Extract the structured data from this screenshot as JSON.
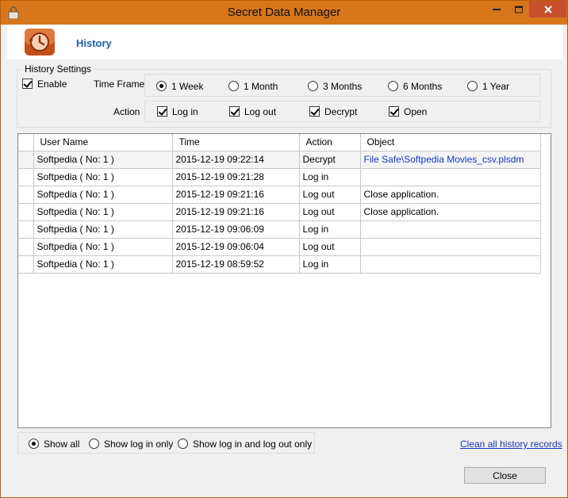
{
  "window": {
    "title": "Secret Data Manager"
  },
  "header": {
    "title": "History"
  },
  "settings": {
    "legend": "History Settings",
    "enable_label": "Enable",
    "enable_checked": true,
    "timeframe_label": "Time Frame",
    "timeframes": [
      {
        "label": "1 Week",
        "selected": true
      },
      {
        "label": "1 Month",
        "selected": false
      },
      {
        "label": "3 Months",
        "selected": false
      },
      {
        "label": "6 Months",
        "selected": false
      },
      {
        "label": "1 Year",
        "selected": false
      }
    ],
    "action_label": "Action",
    "actions": [
      {
        "label": "Log in",
        "checked": true
      },
      {
        "label": "Log out",
        "checked": true
      },
      {
        "label": "Decrypt",
        "checked": true
      },
      {
        "label": "Open",
        "checked": true
      }
    ]
  },
  "table": {
    "columns": [
      "User Name",
      "Time",
      "Action",
      "Object"
    ],
    "rows": [
      {
        "user": "Softpedia ( No: 1 )",
        "time": "2015-12-19 09:22:14",
        "action": "Decrypt",
        "object": "File Safe\\Softpedia Movies_csv.plsdm"
      },
      {
        "user": "Softpedia ( No: 1 )",
        "time": "2015-12-19 09:21:28",
        "action": "Log in",
        "object": ""
      },
      {
        "user": "Softpedia ( No: 1 )",
        "time": "2015-12-19 09:21:16",
        "action": "Log out",
        "object": "Close application."
      },
      {
        "user": "Softpedia ( No: 1 )",
        "time": "2015-12-19 09:21:16",
        "action": "Log out",
        "object": "Close application."
      },
      {
        "user": "Softpedia ( No: 1 )",
        "time": "2015-12-19 09:06:09",
        "action": "Log in",
        "object": ""
      },
      {
        "user": "Softpedia ( No: 1 )",
        "time": "2015-12-19 09:06:04",
        "action": "Log out",
        "object": ""
      },
      {
        "user": "Softpedia ( No: 1 )",
        "time": "2015-12-19 08:59:52",
        "action": "Log in",
        "object": ""
      }
    ]
  },
  "filters": [
    {
      "label": "Show all",
      "selected": true
    },
    {
      "label": "Show log in only",
      "selected": false
    },
    {
      "label": "Show log in and log out only",
      "selected": false
    }
  ],
  "clear_link": "Clean all history records",
  "close_button": "Close",
  "colors": {
    "titlebar": "#d8761b",
    "close_x": "#c7502f",
    "header_title": "#1f5fa8",
    "link": "#1a37b8"
  }
}
